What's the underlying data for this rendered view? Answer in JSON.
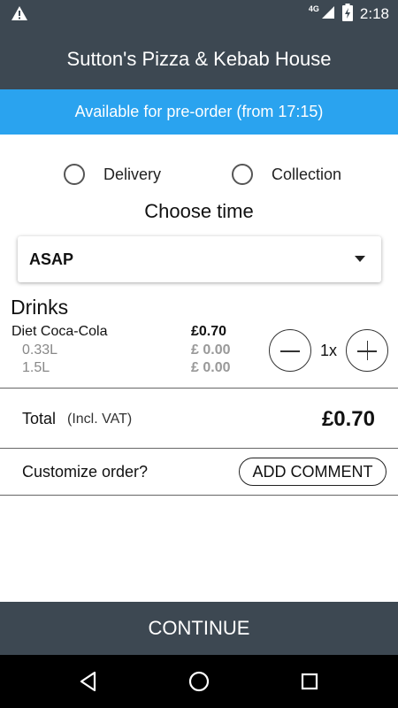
{
  "status_bar": {
    "network": "4G",
    "time": "2:18"
  },
  "header": {
    "title": "Sutton's Pizza & Kebab House"
  },
  "banner": {
    "text": "Available for pre-order (from 17:15)"
  },
  "order_type": {
    "options": [
      {
        "label": "Delivery",
        "selected": false
      },
      {
        "label": "Collection",
        "selected": false
      }
    ]
  },
  "time_section": {
    "title": "Choose time",
    "selected": "ASAP"
  },
  "cart": {
    "category": "Drinks",
    "items": [
      {
        "name": "Diet Coca-Cola",
        "price": "£0.70",
        "variants": [
          {
            "name": "0.33L",
            "price": "£ 0.00"
          },
          {
            "name": "1.5L",
            "price": "£ 0.00"
          }
        ],
        "quantity": "1x"
      }
    ]
  },
  "total": {
    "label": "Total",
    "vat_note": "(Incl. VAT)",
    "value": "£0.70"
  },
  "customize": {
    "label": "Customize order?",
    "button_label": "ADD COMMENT"
  },
  "footer": {
    "continue_label": "CONTINUE"
  },
  "colors": {
    "header_bg": "#3d4852",
    "banner_bg": "#2aa3ef",
    "nav_bg": "#000000"
  },
  "icons": [
    "warning-icon",
    "signal-icon",
    "battery-icon",
    "back-icon",
    "home-icon",
    "recents-icon",
    "minus-icon",
    "plus-icon",
    "dropdown-caret-icon"
  ]
}
